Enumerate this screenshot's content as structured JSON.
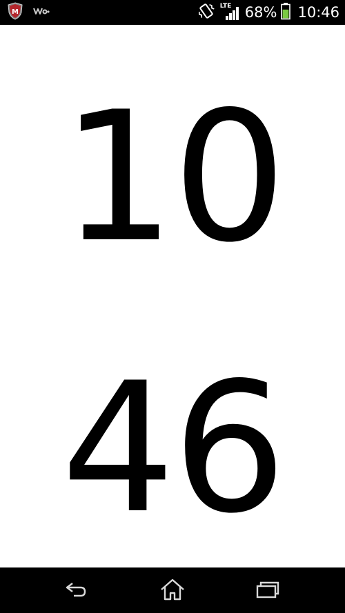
{
  "status_bar": {
    "left_icons": [
      "mcafee-shield-icon",
      "walkman-icon"
    ],
    "right_icons": [
      "vibrate-icon",
      "lte-signal-icon",
      "battery-icon"
    ],
    "network_label": "LTE",
    "battery_percent": "68%",
    "battery_level": 0.68,
    "battery_color": "#7ac943",
    "time": "10:46"
  },
  "clock": {
    "hours": "10",
    "minutes": "46"
  },
  "nav_bar": {
    "buttons": [
      "back-icon",
      "home-icon",
      "recents-icon"
    ]
  },
  "colors": {
    "background": "#ffffff",
    "digits": "#000000",
    "bars": "#000000",
    "nav_icon": "#d9d9d9"
  }
}
